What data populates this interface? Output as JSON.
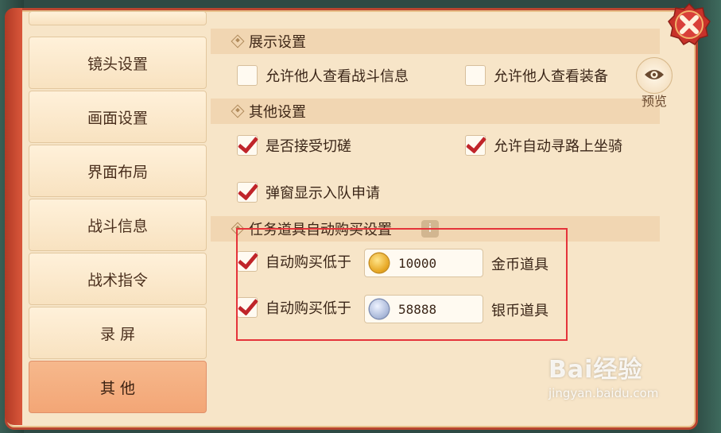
{
  "sidebar": {
    "items": [
      {
        "label": "镜头设置",
        "active": false
      },
      {
        "label": "画面设置",
        "active": false
      },
      {
        "label": "界面布局",
        "active": false
      },
      {
        "label": "战斗信息",
        "active": false
      },
      {
        "label": "战术指令",
        "active": false
      },
      {
        "label": "录 屏",
        "active": false
      },
      {
        "label": "其 他",
        "active": true
      }
    ]
  },
  "sections": {
    "display": {
      "title": "展示设置",
      "options": [
        {
          "label": "允许他人查看战斗信息",
          "checked": false
        },
        {
          "label": "允许他人查看装备",
          "checked": false
        }
      ]
    },
    "other": {
      "title": "其他设置",
      "options": [
        {
          "label": "是否接受切磋",
          "checked": true
        },
        {
          "label": "允许自动寻路上坐骑",
          "checked": true
        },
        {
          "label": "弹窗显示入队申请",
          "checked": true
        }
      ]
    },
    "auto_buy": {
      "title": "任务道具自动购买设置",
      "rows": [
        {
          "label": "自动购买低于",
          "value": "10000",
          "suffix": "金币道具",
          "checked": true,
          "coin": "gold-coin-icon"
        },
        {
          "label": "自动购买低于",
          "value": "58888",
          "suffix": "银币道具",
          "checked": true,
          "coin": "silver-coin-icon"
        }
      ]
    }
  },
  "preview": {
    "label": "预览",
    "icon": "eye-icon"
  },
  "close": {
    "icon": "close-icon"
  },
  "watermark": {
    "main": "Bai经验",
    "sub": "jingyan.baidu.com"
  },
  "colors": {
    "frame": "#b9452f",
    "check": "#c0252a",
    "active_tab": "#f3a676",
    "highlight_box": "#e5333a"
  }
}
